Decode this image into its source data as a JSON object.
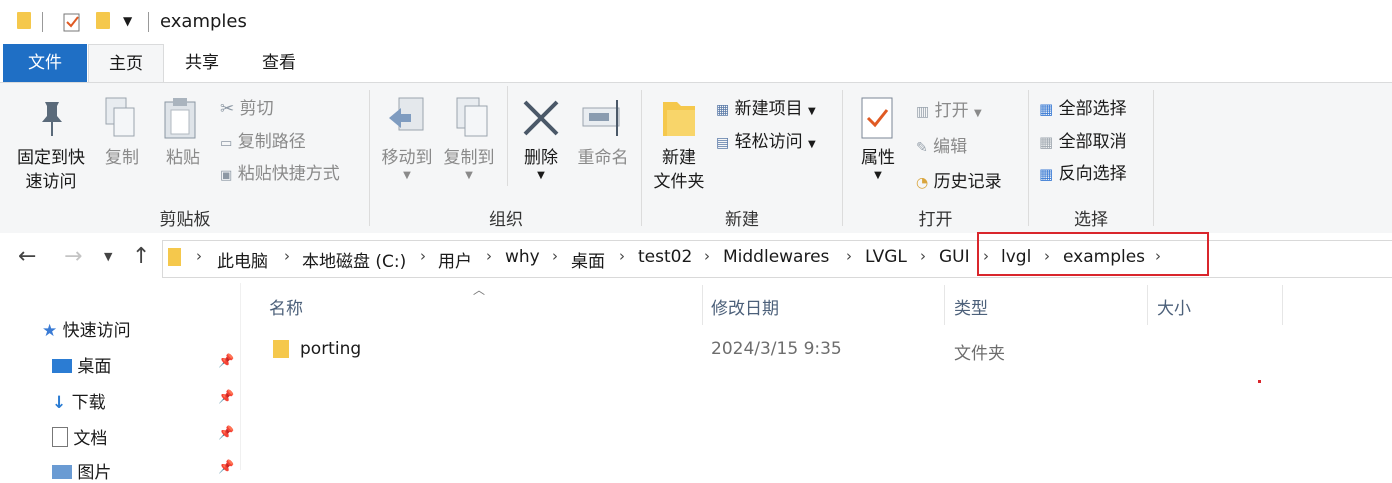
{
  "window": {
    "title": "examples"
  },
  "tabs": [
    {
      "label": "文件"
    },
    {
      "label": "主页"
    },
    {
      "label": "共享"
    },
    {
      "label": "查看"
    }
  ],
  "ribbon": {
    "clipboard": {
      "group_label": "剪贴板",
      "pin_quick": "固定到快\n速访问",
      "pin_quick_l1": "固定到快",
      "pin_quick_l2": "速访问",
      "copy": "复制",
      "paste": "粘贴",
      "cut": "剪切",
      "copy_path": "复制路径",
      "paste_shortcut": "粘贴快捷方式"
    },
    "organize": {
      "group_label": "组织",
      "move_to": "移动到",
      "copy_to": "复制到",
      "delete": "删除",
      "rename": "重命名"
    },
    "new": {
      "group_label": "新建",
      "new_folder_l1": "新建",
      "new_folder_l2": "文件夹",
      "new_item": "新建项目",
      "easy_access": "轻松访问"
    },
    "open": {
      "group_label": "打开",
      "properties": "属性",
      "open": "打开",
      "edit": "编辑",
      "history": "历史记录"
    },
    "select": {
      "group_label": "选择",
      "select_all": "全部选择",
      "select_none": "全部取消",
      "invert": "反向选择"
    }
  },
  "breadcrumb": [
    "此电脑",
    "本地磁盘 (C:)",
    "用户",
    "why",
    "桌面",
    "test02",
    "Middlewares",
    "LVGL",
    "GUI",
    "lvgl",
    "examples"
  ],
  "nav_pane": {
    "quick_access": "快速访问",
    "items": [
      {
        "label": "桌面",
        "icon": "desktop-icon"
      },
      {
        "label": "下载",
        "icon": "download-icon"
      },
      {
        "label": "文档",
        "icon": "document-icon"
      },
      {
        "label": "图片",
        "icon": "picture-icon"
      }
    ]
  },
  "file_list": {
    "columns": {
      "name": "名称",
      "modified": "修改日期",
      "type": "类型",
      "size": "大小"
    },
    "rows": [
      {
        "name": "porting",
        "modified": "2024/3/15 9:35",
        "type": "文件夹",
        "size": ""
      }
    ]
  },
  "colors": {
    "file_tab": "#1f6fc5",
    "highlight": "#d9262c",
    "folder": "#f5c84c"
  }
}
